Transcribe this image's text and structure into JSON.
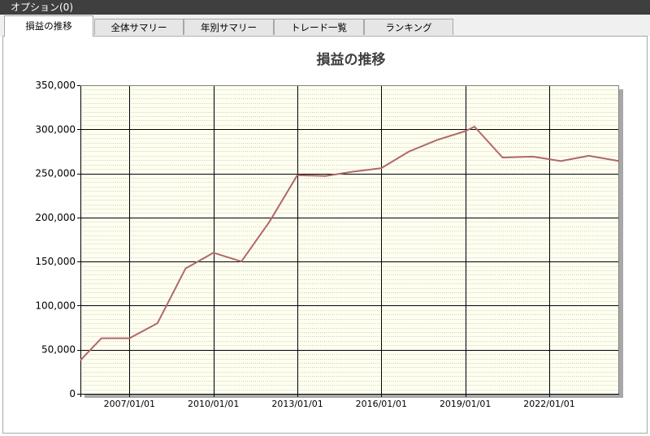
{
  "window": {
    "title": "オプション(0)"
  },
  "tabs": [
    {
      "label": "損益の推移",
      "active": true
    },
    {
      "label": "全体サマリー",
      "active": false
    },
    {
      "label": "年別サマリー",
      "active": false
    },
    {
      "label": "トレード一覧",
      "active": false
    },
    {
      "label": "ランキング",
      "active": false
    }
  ],
  "colors": {
    "plot_background": "#fffff0",
    "line": "#b06868",
    "titlebar": "#3f3f3f"
  },
  "chart_data": {
    "type": "line",
    "title": "損益の推移",
    "xlabel": "",
    "ylabel": "",
    "ylim": [
      0,
      350000
    ],
    "xlim": [
      "2005/04/01",
      "2024/07/01"
    ],
    "y_ticks": [
      "0",
      "50,000",
      "100,000",
      "150,000",
      "200,000",
      "250,000",
      "300,000",
      "350,000"
    ],
    "y_tick_values": [
      0,
      50000,
      100000,
      150000,
      200000,
      250000,
      300000,
      350000
    ],
    "x_ticks": [
      "2007/01/01",
      "2010/01/01",
      "2013/01/01",
      "2016/01/01",
      "2019/01/01",
      "2022/01/01"
    ],
    "grid": true,
    "legend": "none",
    "series": [
      {
        "x": [
          "2005/04/01",
          "2006/01/01",
          "2007/01/01",
          "2008/01/01",
          "2009/01/01",
          "2010/01/01",
          "2011/01/01",
          "2012/01/01",
          "2013/01/01",
          "2014/01/01",
          "2015/01/01",
          "2016/01/01",
          "2017/01/01",
          "2018/01/01",
          "2019/01/01",
          "2019/05/01",
          "2020/05/01",
          "2021/06/01",
          "2022/06/01",
          "2023/06/01",
          "2024/07/01"
        ],
        "values": [
          38000,
          63000,
          63000,
          80000,
          142000,
          160000,
          150000,
          195000,
          248000,
          247000,
          252000,
          256000,
          275000,
          288000,
          298000,
          303000,
          268000,
          269000,
          264000,
          270000,
          264000
        ]
      }
    ]
  }
}
